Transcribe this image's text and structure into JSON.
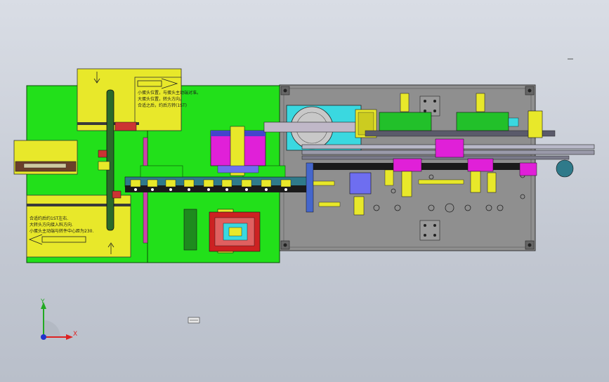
{
  "app": {
    "viewport_name": "cad-graphics-area"
  },
  "annotations": {
    "top_note_lines": [
      "小蛋头位置，与蛋头主动端对准。",
      "大蛋头位置，转头方向。",
      "合适之后，约后方转(1ST)"
    ],
    "bottom_note_lines": [
      "合适约后约1ST左右.",
      "大转头方向接入料方向.",
      "小蛋头主动端与转件中心距为230."
    ]
  },
  "triad": {
    "x_label": "X",
    "y_label": "Y"
  },
  "colors": {
    "background": "#c9ced8",
    "green_frame": "#22e01a",
    "yellow_panel": "#e8e82a",
    "grey_plate": "#8e8e8e",
    "cyan_block": "#3ad8e0",
    "magenta_block": "#e020d8"
  }
}
